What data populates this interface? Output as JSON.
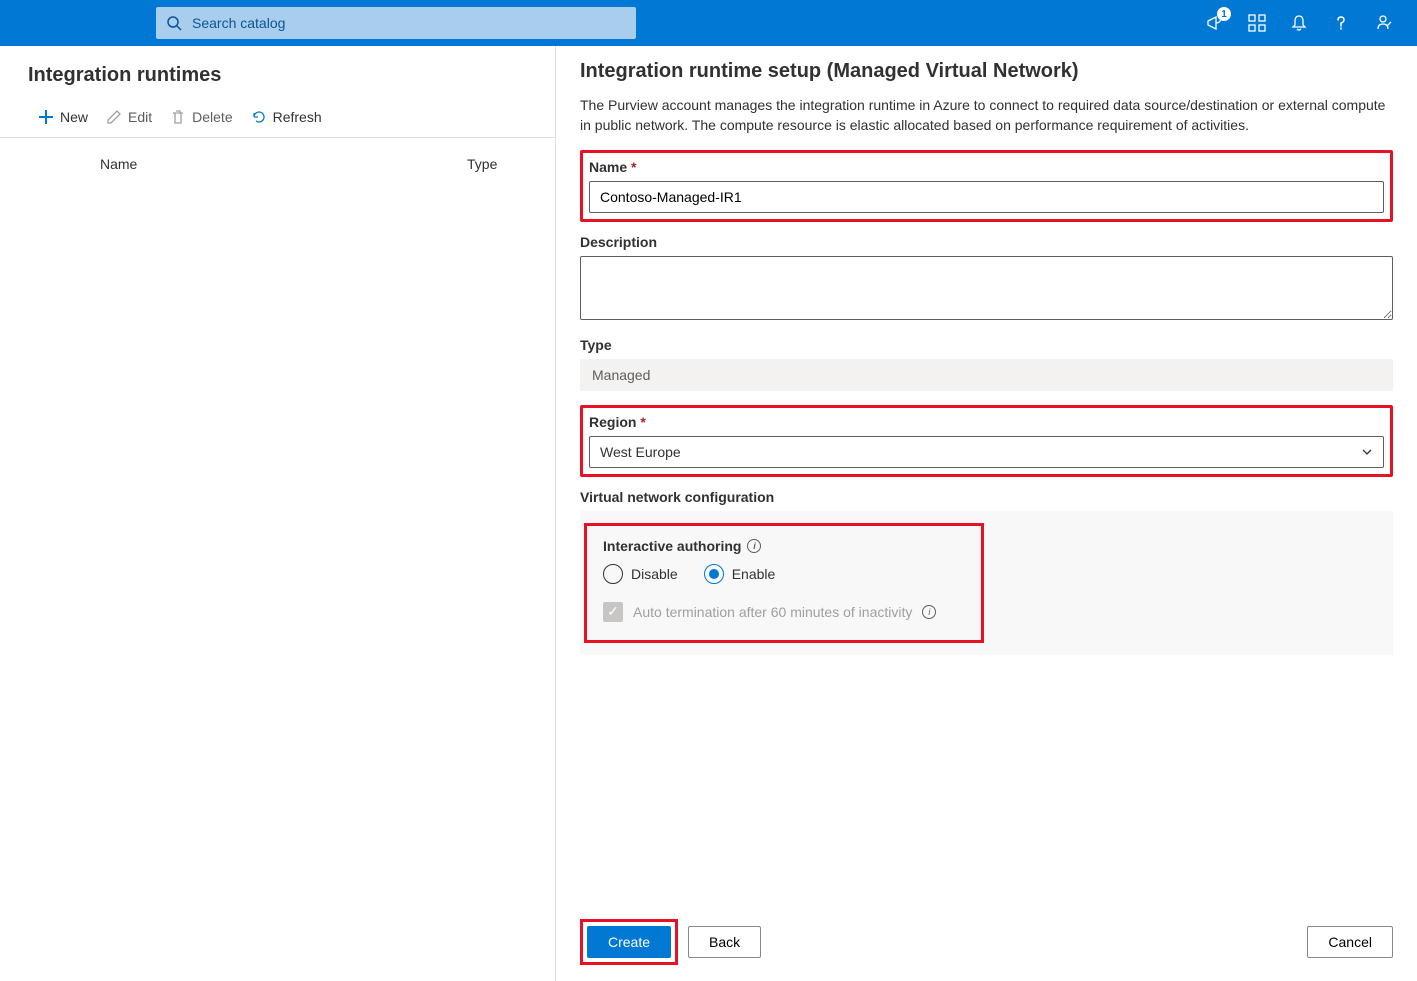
{
  "topbar": {
    "search_placeholder": "Search catalog",
    "badge_count": "1"
  },
  "left": {
    "title": "Integration runtimes",
    "toolbar": {
      "new": "New",
      "edit": "Edit",
      "delete": "Delete",
      "refresh": "Refresh"
    },
    "columns": {
      "name": "Name",
      "type": "Type"
    }
  },
  "panel": {
    "title": "Integration runtime setup (Managed Virtual Network)",
    "description": "The Purview account manages the integration runtime in Azure to connect to required data source/destination or external compute in public network. The compute resource is elastic allocated based on performance requirement of activities.",
    "name_label": "Name",
    "name_value": "Contoso-Managed-IR1",
    "description_label": "Description",
    "description_value": "",
    "type_label": "Type",
    "type_value": "Managed",
    "region_label": "Region",
    "region_value": "West Europe",
    "vnet_label": "Virtual network configuration",
    "auth_label": "Interactive authoring",
    "radio_disable": "Disable",
    "radio_enable": "Enable",
    "auto_term_label": "Auto termination after 60 minutes of inactivity",
    "buttons": {
      "create": "Create",
      "back": "Back",
      "cancel": "Cancel"
    }
  }
}
